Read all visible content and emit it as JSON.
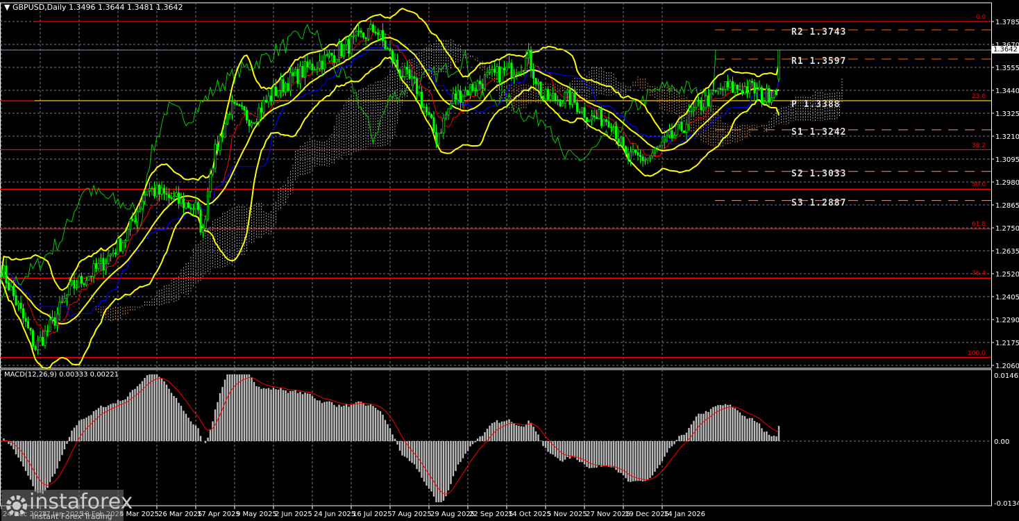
{
  "header": {
    "symbol_tf": "GBPUSD,Daily",
    "ohlc": "1.3496 1.3644 1.3481 1.3642"
  },
  "macd_header": {
    "label": "MACD(12,26,9) 0.00333 0.00221"
  },
  "current_price": "1.3642",
  "pivots": [
    {
      "label": "R2 1.3743",
      "value": 1.3743,
      "color": "#ff6a00"
    },
    {
      "label": "R1 1.3597",
      "value": 1.3597,
      "color": "#ff6a00"
    },
    {
      "label": "P 1.3388",
      "value": 1.3388,
      "color": "#ffd700"
    },
    {
      "label": "S1 1.3242",
      "value": 1.3242,
      "color": "#e0a090"
    },
    {
      "label": "S2 1.3033",
      "value": 1.3033,
      "color": "#e0a090"
    },
    {
      "label": "S3 1.2887",
      "value": 1.2887,
      "color": "#e0a090"
    }
  ],
  "fib_levels": [
    {
      "label": "0.0",
      "value": 1.3785
    },
    {
      "label": "23.6",
      "value": 1.3387
    },
    {
      "label": "38.2",
      "value": 1.3142
    },
    {
      "label": "50.0",
      "value": 1.2944
    },
    {
      "label": "61.8",
      "value": 1.2745
    },
    {
      "label": "76.4",
      "value": 1.2498
    },
    {
      "label": "100.0",
      "value": 1.21
    }
  ],
  "watermark": {
    "brand": "instaforex",
    "tagline": "Instant Forex Trading"
  },
  "colors": {
    "candle": "#00ff00",
    "bollinger": "#ffff00",
    "tenkan": "#ff0000",
    "kijun": "#0000ff",
    "chikou": "#00cc00",
    "cloud": "#f4a460",
    "fib": "#ff0000",
    "macd_hist": "#c0c0c0",
    "macd_signal": "#ff0000"
  },
  "chart_data": {
    "type": "line",
    "title": "GBPUSD,Daily",
    "price_axis_ticks": [
      "1.3785",
      "1.3670",
      "1.3555",
      "1.3440",
      "1.3325",
      "1.3210",
      "1.3095",
      "1.2980",
      "1.2865",
      "1.2750",
      "1.2635",
      "1.2520",
      "1.2405",
      "1.2290",
      "1.2175",
      "1.2060"
    ],
    "price_range": [
      1.206,
      1.3785
    ],
    "macd_axis_ticks": [
      "0.01465",
      "0.00",
      "-0.01343"
    ],
    "macd_range": [
      -0.01343,
      0.01465
    ],
    "date_ticks": [
      "24 Dec 2024",
      "17 Jan 2025",
      "10 Feb 2025",
      "4 Mar 2025",
      "26 Mar 2025",
      "17 Apr 2025",
      "9 May 2025",
      "2 Jun 2025",
      "24 Jun 2025",
      "16 Jul 2025",
      "7 Aug 2025",
      "29 Aug 2025",
      "22 Sep 2025",
      "14 Oct 2025",
      "5 Nov 2025",
      "27 Nov 2025",
      "19 Dec 2025",
      "14 Jan 2026"
    ],
    "bars_per_date_tick": 16,
    "close_anchors": [
      [
        0,
        1.255
      ],
      [
        14,
        1.215
      ],
      [
        20,
        1.225
      ],
      [
        29,
        1.245
      ],
      [
        40,
        1.255
      ],
      [
        51,
        1.27
      ],
      [
        60,
        1.295
      ],
      [
        69,
        1.29
      ],
      [
        80,
        1.285
      ],
      [
        83,
        1.272
      ],
      [
        86,
        1.305
      ],
      [
        94,
        1.335
      ],
      [
        103,
        1.33
      ],
      [
        114,
        1.345
      ],
      [
        126,
        1.355
      ],
      [
        134,
        1.36
      ],
      [
        150,
        1.372
      ],
      [
        154,
        1.375
      ],
      [
        163,
        1.355
      ],
      [
        171,
        1.345
      ],
      [
        179,
        1.32
      ],
      [
        186,
        1.34
      ],
      [
        200,
        1.35
      ],
      [
        211,
        1.355
      ],
      [
        217,
        1.36
      ],
      [
        223,
        1.34
      ],
      [
        234,
        1.34
      ],
      [
        243,
        1.33
      ],
      [
        251,
        1.33
      ],
      [
        257,
        1.31
      ],
      [
        266,
        1.31
      ],
      [
        271,
        1.315
      ],
      [
        280,
        1.325
      ],
      [
        286,
        1.335
      ],
      [
        297,
        1.345
      ],
      [
        309,
        1.345
      ],
      [
        314,
        1.34
      ],
      [
        319,
        1.346
      ]
    ],
    "last_bar": {
      "open": 1.3496,
      "high": 1.3644,
      "low": 1.3481,
      "close": 1.3642
    },
    "macd_last": {
      "macd": 0.00333,
      "signal": 0.00221
    },
    "grid": true
  }
}
